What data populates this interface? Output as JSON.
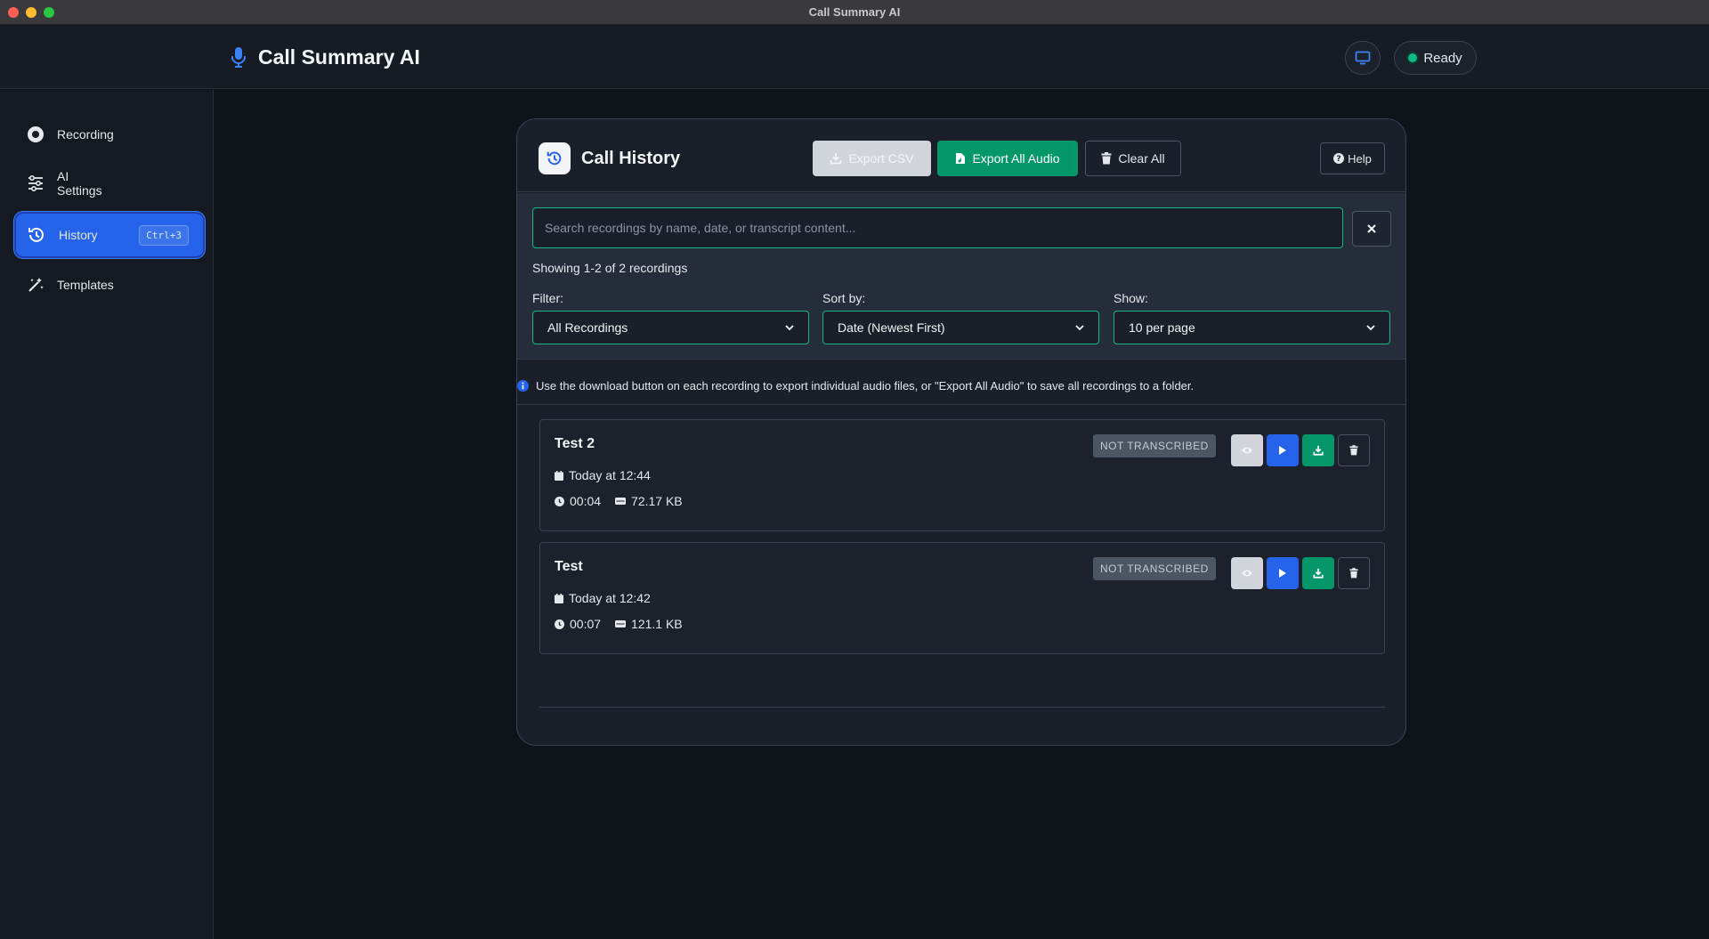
{
  "window": {
    "title": "Call Summary AI"
  },
  "header": {
    "app_name": "Call Summary AI",
    "status": "Ready"
  },
  "sidebar": {
    "items": [
      {
        "label": "Recording",
        "icon": "record-icon"
      },
      {
        "label": "AI\nSettings",
        "icon": "sliders-icon"
      },
      {
        "label": "History",
        "icon": "history-icon",
        "shortcut": "Ctrl+3",
        "active": true
      },
      {
        "label": "Templates",
        "icon": "magic-wand-icon"
      }
    ]
  },
  "history": {
    "title": "Call History",
    "export_csv": "Export CSV",
    "export_all_audio": "Export All Audio",
    "clear_all": "Clear All",
    "help": "Help",
    "search_placeholder": "Search recordings by name, date, or transcript content...",
    "showing": "Showing 1-2 of 2 recordings",
    "filter_label": "Filter:",
    "filter_value": "All Recordings",
    "sort_label": "Sort by:",
    "sort_value": "Date (Newest First)",
    "show_label": "Show:",
    "show_value": "10 per page",
    "info_text": "Use the download button on each recording to export individual audio files, or \"Export All Audio\" to save all recordings to a folder.",
    "recordings": [
      {
        "name": "Test 2",
        "date": "Today at 12:44",
        "duration": "00:04",
        "size": "72.17 KB",
        "status": "NOT TRANSCRIBED"
      },
      {
        "name": "Test",
        "date": "Today at 12:42",
        "duration": "00:07",
        "size": "121.1 KB",
        "status": "NOT TRANSCRIBED"
      }
    ]
  },
  "colors": {
    "accent": "#2563eb",
    "success": "#059669",
    "focus": "#10b981",
    "background": "#0f131a"
  }
}
